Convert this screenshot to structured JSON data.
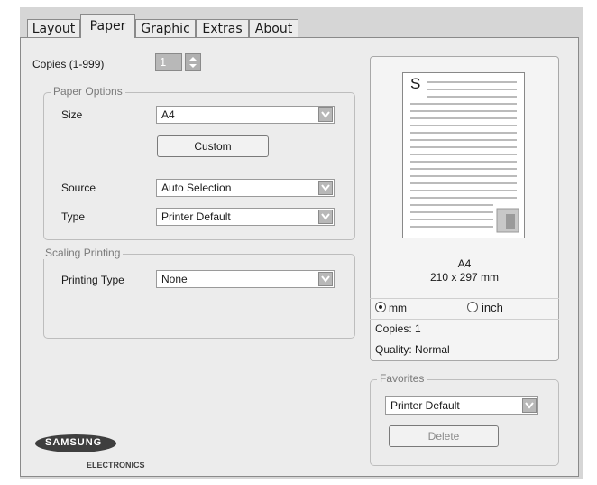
{
  "tabs": [
    {
      "label": "Layout"
    },
    {
      "label": "Paper"
    },
    {
      "label": "Graphic"
    },
    {
      "label": "Extras"
    },
    {
      "label": "About"
    }
  ],
  "copies": {
    "label": "Copies (1-999)",
    "value": "1"
  },
  "paper_options": {
    "title": "Paper Options",
    "size_label": "Size",
    "size_value": "A4",
    "custom_label": "Custom",
    "source_label": "Source",
    "source_value": "Auto Selection",
    "type_label": "Type",
    "type_value": "Printer Default"
  },
  "scaling": {
    "title": "Scaling Printing",
    "type_label": "Printing Type",
    "type_value": "None"
  },
  "preview": {
    "page_letter": "S",
    "paper_name": "A4",
    "paper_dims": "210 x 297 mm",
    "unit_mm": "mm",
    "unit_inch": "inch",
    "copies": "Copies: 1",
    "quality": "Quality: Normal"
  },
  "favorites": {
    "title": "Favorites",
    "value": "Printer Default",
    "delete_label": "Delete"
  },
  "logo": {
    "brand": "SAMSUNG",
    "sub": "ELECTRONICS"
  }
}
